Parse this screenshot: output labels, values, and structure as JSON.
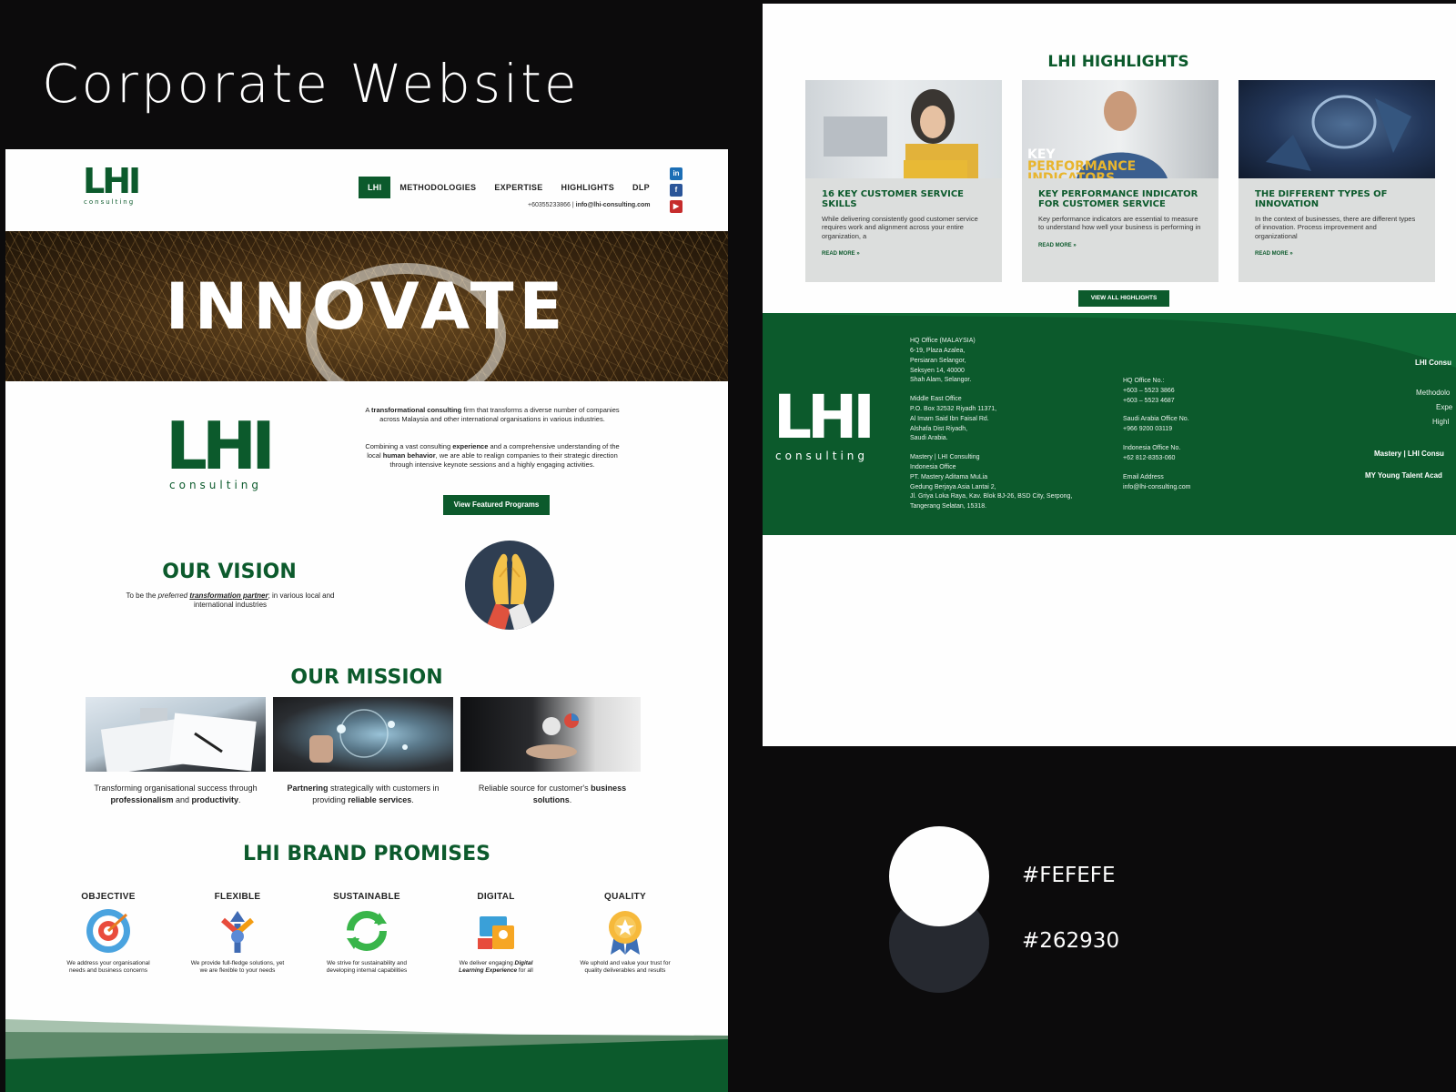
{
  "heading": "Corporate Website",
  "left": {
    "logo": {
      "text": "LHI",
      "sub": "consulting"
    },
    "nav": [
      "LHI",
      "METHODOLOGIES",
      "EXPERTISE",
      "HIGHLIGHTS",
      "DLP"
    ],
    "contact_phone": "+60355233866 | ",
    "contact_email": "info@lhi-consulting.com",
    "social": [
      "linkedin-icon",
      "facebook-icon",
      "youtube-icon"
    ],
    "hero_text": "INNOVATE",
    "intro": {
      "p1_pre": "A ",
      "p1_bold": "transformational consulting",
      "p1_post": " firm that transforms a diverse number of companies across Malaysia and other international organisations in various industries.",
      "p2_pre": "Combining a vast consulting ",
      "p2_bold1": "experience",
      "p2_mid": " and a comprehensive understanding of the local ",
      "p2_bold2": "human behavior",
      "p2_post": ", we are able to realign companies to their strategic direction through intensive keynote sessions and  a highly engaging activities."
    },
    "featured_button": "View Featured Programs",
    "vision": {
      "title": "OUR VISION",
      "text_pre": "To be the ",
      "text_em": "preferred ",
      "text_bold": "transformation partner",
      "text_post": "; in various local and international industries"
    },
    "mission": {
      "title": "OUR MISSION",
      "items": [
        {
          "pre": "Transforming organisational success through ",
          "b1": "professionalism",
          "mid": " and ",
          "b2": "productivity",
          "post": "."
        },
        {
          "b1": "Partnering",
          "mid": " strategically with customers in providing ",
          "b2": "reliable services",
          "post": "."
        },
        {
          "pre": "Reliable source for customer's ",
          "b1": "business solutions",
          "post": "."
        }
      ]
    },
    "promises": {
      "title": "LHI BRAND PROMISES",
      "items": [
        {
          "title": "OBJECTIVE",
          "icon": "target-icon",
          "desc": "We address your organisational needs and business concerns"
        },
        {
          "title": "FLEXIBLE",
          "icon": "flexible-arrows-icon",
          "desc": "We provide full-fledge solutions, yet we are flexible to your needs"
        },
        {
          "title": "SUSTAINABLE",
          "icon": "recycle-icon",
          "desc": "We strive for sustainability and developing internal capabilities"
        },
        {
          "title": "DIGITAL",
          "icon": "digital-devices-icon",
          "desc_pre": "We deliver engaging ",
          "desc_em": "Digital Learning Experience",
          "desc_post": " for all"
        },
        {
          "title": "QUALITY",
          "icon": "quality-medal-icon",
          "desc": "We uphold and value your trust for quality deliverables and results"
        }
      ]
    }
  },
  "right": {
    "highlights_title": "LHI HIGHLIGHTS",
    "cards": [
      {
        "title": "16 KEY CUSTOMER SERVICE SKILLS",
        "body": "While delivering consistently good customer service requires work and alignment across your entire organization, a",
        "more": "READ MORE »"
      },
      {
        "title": "KEY PERFORMANCE INDICATOR FOR CUSTOMER SERVICE",
        "body": "Key performance indicators are essential to measure to understand how well your business is performing in",
        "more": "READ MORE »",
        "img_text1": "KEY",
        "img_text2": "PERFORMANCE",
        "img_text3": "INDICATORS"
      },
      {
        "title": "THE DIFFERENT TYPES OF INNOVATION",
        "body": "In the context of businesses, there are different types of innovation. Process improvement and organizational",
        "more": "READ MORE »"
      }
    ],
    "view_all": "VIEW ALL HIGHLIGHTS",
    "footer": {
      "logo": {
        "text": "LHI",
        "sub": "consulting"
      },
      "col1": [
        "HQ Office (MALAYSIA)",
        "6-19, Plaza Azalea,",
        "Persiaran Selangor,",
        "Seksyen 14, 40000",
        "Shah Alam, Selangor.",
        "Middle East Office",
        "P.O. Box 32532 Riyadh 11371,",
        "Al Imam Said Ibn Faisal Rd.",
        "Alshafa Dist Riyadh,",
        "Saudi Arabia.",
        "Mastery | LHI Consulting",
        "Indonesia Office",
        "PT. Mastery Aditama MuLia",
        "Gedung Berjaya Asia Lantai 2,",
        "Jl. Griya Loka Raya, Kav. Blok BJ-26, BSD City, Serpong,",
        "Tangerang Selatan, 15318."
      ],
      "col2": [
        "HQ Office No.:",
        "+603 – 5523 3866",
        "+603 – 5523 4687",
        "Saudi Arabia Office No.",
        "+966 9200 03119",
        "Indonesia Office No.",
        "+62 812-8353-060",
        "Email Address",
        "info@lhi-consulting.com"
      ],
      "col3": [
        "LHI Consu",
        "Methodolo",
        "Expe",
        "Highl",
        "Mastery | LHI Consu",
        "MY Young Talent Acad"
      ]
    }
  },
  "palette": [
    {
      "hex": "#FEFEFE",
      "label": "#FEFEFE"
    },
    {
      "hex": "#262930",
      "label": "#262930"
    }
  ]
}
